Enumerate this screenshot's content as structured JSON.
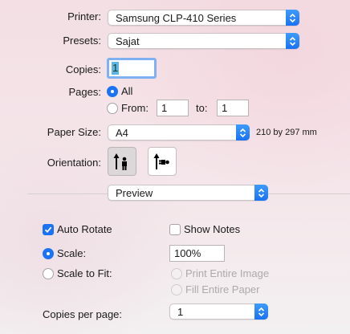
{
  "printer": {
    "label": "Printer:",
    "value": "Samsung CLP-410 Series"
  },
  "presets": {
    "label": "Presets:",
    "value": "Sajat"
  },
  "copies": {
    "label": "Copies:",
    "value": "1"
  },
  "pages": {
    "label": "Pages:",
    "all_label": "All",
    "from_label": "From:",
    "from_value": "1",
    "to_label": "to:",
    "to_value": "1"
  },
  "paper_size": {
    "label": "Paper Size:",
    "value": "A4",
    "dimensions": "210 by 297 mm"
  },
  "orientation": {
    "label": "Orientation:",
    "selected": "portrait"
  },
  "section_popup": {
    "value": "Preview"
  },
  "auto_rotate": {
    "label": "Auto Rotate",
    "checked": true
  },
  "show_notes": {
    "label": "Show Notes",
    "checked": false
  },
  "scale": {
    "label": "Scale:",
    "value": "100%"
  },
  "scale_to_fit": {
    "label": "Scale to Fit:",
    "print_entire_image": "Print Entire Image",
    "fill_entire_paper": "Fill Entire Paper"
  },
  "copies_per_page": {
    "label": "Copies per page:",
    "value": "1"
  },
  "colors": {
    "accent": "#1a73f4",
    "background": "#f3dfe4"
  }
}
